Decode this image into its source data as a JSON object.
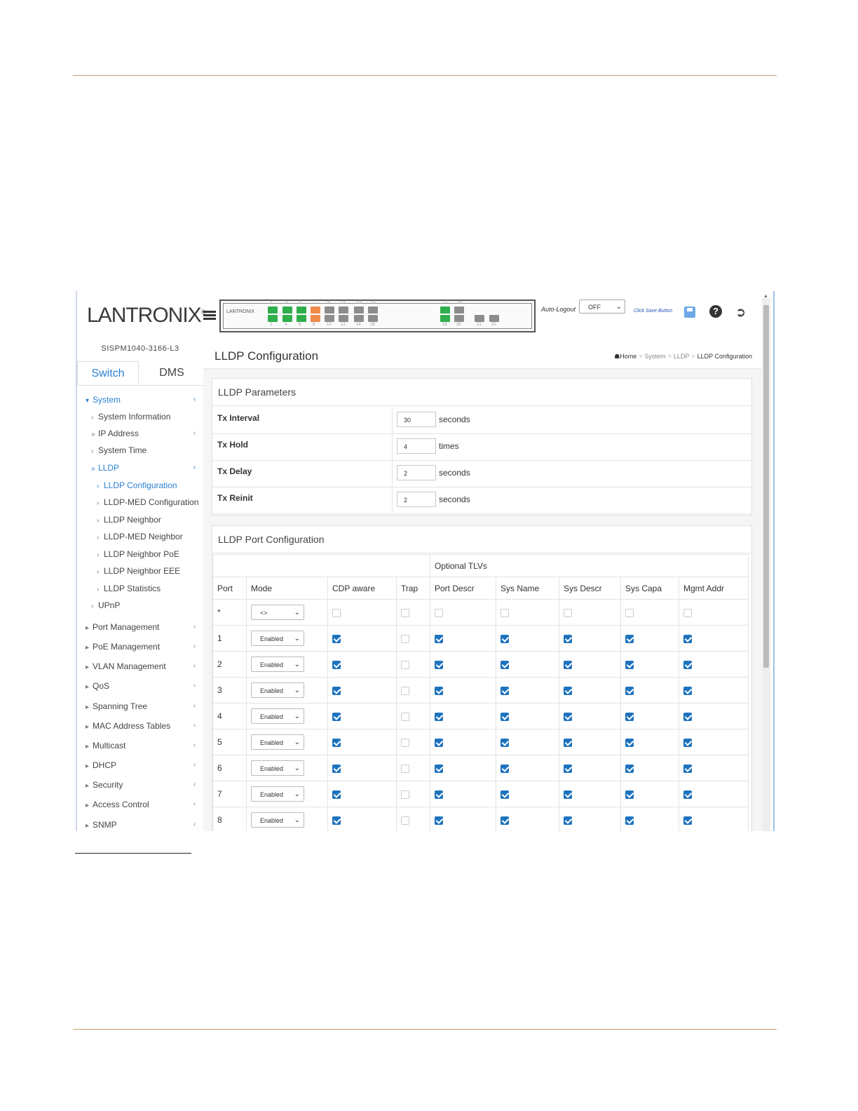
{
  "app": {
    "brand": "LANTRONIX",
    "brand_mark": "®",
    "model": "SISPM1040-3166-L3",
    "panel_brand": "LANTRONIX",
    "auto_logout_label": "Auto-Logout",
    "auto_logout_value": "OFF",
    "save_hint": "Click Save Button",
    "icons": {
      "menu": "hamburger-icon",
      "save": "save-icon",
      "help": "help-icon",
      "logout": "logout-icon",
      "home": "home-icon"
    },
    "colors": {
      "accent": "#2a7fd4",
      "checkbox": "#1e73be",
      "port_green": "#2fae4c",
      "port_orange": "#f08a4b",
      "port_gray": "#8c8c8c",
      "rule": "#c49a6c"
    }
  },
  "ports_panel": {
    "top_labels": [
      "1",
      "3",
      "5",
      "7",
      "9",
      "11",
      "13",
      "15",
      "17",
      "19"
    ],
    "bottom_labels": [
      "2",
      "4",
      "6",
      "8",
      "10",
      "12",
      "14",
      "16",
      "18",
      "20",
      "21",
      "22"
    ]
  },
  "tabs": [
    "Switch",
    "DMS"
  ],
  "nav": [
    {
      "label": "System"
    },
    {
      "label": "System Information"
    },
    {
      "label": "IP Address"
    },
    {
      "label": "System Time"
    },
    {
      "label": "LLDP"
    },
    {
      "label": "LLDP Configuration"
    },
    {
      "label": "LLDP-MED Configuration"
    },
    {
      "label": "LLDP Neighbor"
    },
    {
      "label": "LLDP-MED Neighbor"
    },
    {
      "label": "LLDP Neighbor PoE"
    },
    {
      "label": "LLDP Neighbor EEE"
    },
    {
      "label": "LLDP Statistics"
    },
    {
      "label": "UPnP"
    },
    {
      "label": "Port Management"
    },
    {
      "label": "PoE Management"
    },
    {
      "label": "VLAN Management"
    },
    {
      "label": "QoS"
    },
    {
      "label": "Spanning Tree"
    },
    {
      "label": "MAC Address Tables"
    },
    {
      "label": "Multicast"
    },
    {
      "label": "DHCP"
    },
    {
      "label": "Security"
    },
    {
      "label": "Access Control"
    },
    {
      "label": "SNMP"
    }
  ],
  "page": {
    "title": "LLDP Configuration",
    "breadcrumb": [
      "Home",
      "System",
      "LLDP",
      "LLDP Configuration"
    ]
  },
  "params": {
    "title": "LLDP Parameters",
    "rows": [
      {
        "label": "Tx Interval",
        "value": "30",
        "unit": "seconds"
      },
      {
        "label": "Tx Hold",
        "value": "4",
        "unit": "times"
      },
      {
        "label": "Tx Delay",
        "value": "2",
        "unit": "seconds"
      },
      {
        "label": "Tx Reinit",
        "value": "2",
        "unit": "seconds"
      }
    ]
  },
  "port_config": {
    "title": "LLDP Port Configuration",
    "group_header": "Optional TLVs",
    "columns": [
      "Port",
      "Mode",
      "CDP aware",
      "Trap",
      "Port Descr",
      "Sys Name",
      "Sys Descr",
      "Sys Capa",
      "Mgmt Addr"
    ],
    "rows": [
      {
        "port": "*",
        "mode": "<>",
        "checks": [
          false,
          false,
          false,
          false,
          false,
          false,
          false
        ]
      },
      {
        "port": "1",
        "mode": "Enabled",
        "checks": [
          true,
          false,
          true,
          true,
          true,
          true,
          true
        ]
      },
      {
        "port": "2",
        "mode": "Enabled",
        "checks": [
          true,
          false,
          true,
          true,
          true,
          true,
          true
        ]
      },
      {
        "port": "3",
        "mode": "Enabled",
        "checks": [
          true,
          false,
          true,
          true,
          true,
          true,
          true
        ]
      },
      {
        "port": "4",
        "mode": "Enabled",
        "checks": [
          true,
          false,
          true,
          true,
          true,
          true,
          true
        ]
      },
      {
        "port": "5",
        "mode": "Enabled",
        "checks": [
          true,
          false,
          true,
          true,
          true,
          true,
          true
        ]
      },
      {
        "port": "6",
        "mode": "Enabled",
        "checks": [
          true,
          false,
          true,
          true,
          true,
          true,
          true
        ]
      },
      {
        "port": "7",
        "mode": "Enabled",
        "checks": [
          true,
          false,
          true,
          true,
          true,
          true,
          true
        ]
      },
      {
        "port": "8",
        "mode": "Enabled",
        "checks": [
          true,
          false,
          true,
          true,
          true,
          true,
          true
        ]
      }
    ]
  }
}
